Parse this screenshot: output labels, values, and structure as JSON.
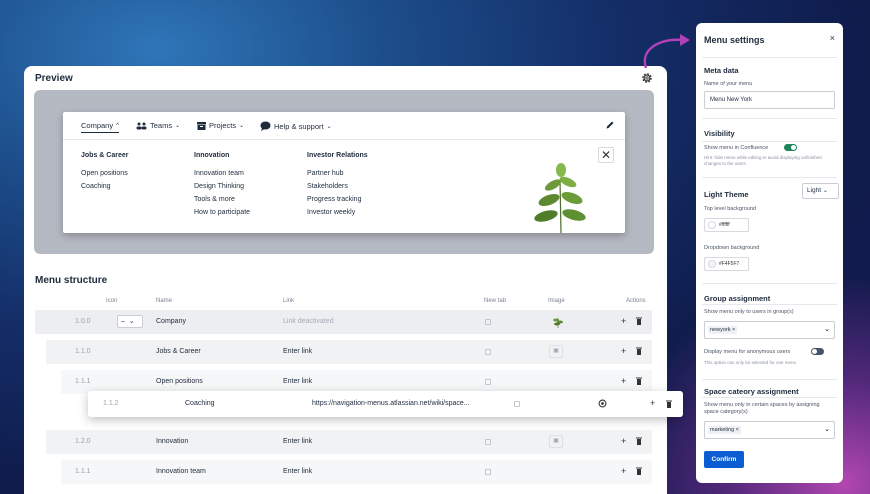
{
  "preview": {
    "title": "Preview",
    "nav": [
      "Company",
      "Teams",
      "Projects",
      "Help & support"
    ],
    "columns": [
      {
        "heading": "Jobs & Career",
        "items": [
          "Open positions",
          "Coaching"
        ]
      },
      {
        "heading": "Innovation",
        "items": [
          "Innovation team",
          "Design Thinking",
          "Tools & more",
          "How to participate"
        ]
      },
      {
        "heading": "Investor Relations",
        "items": [
          "Partner hub",
          "Stakeholders",
          "Progress tracking",
          "Investor weekly"
        ]
      }
    ]
  },
  "structure": {
    "title": "Menu structure",
    "headers": {
      "icon": "Icon",
      "name": "Name",
      "link": "Link",
      "newtab": "New tab",
      "image": "Image",
      "actions": "Actions"
    },
    "rows": [
      {
        "idx": "1.0.0",
        "name": "Company",
        "link": "Link deactivated"
      },
      {
        "idx": "1.1.0",
        "name": "Jobs & Career",
        "link": "Enter link"
      },
      {
        "idx": "1.1.1",
        "name": "Open positions",
        "link": "Enter link"
      },
      {
        "idx": "1.1.2",
        "name": "Coaching",
        "link": "https://navigation-menus.atlassian.net/wiki/space..."
      },
      {
        "idx": "1.2.0",
        "name": "Innovation",
        "link": "Enter link"
      },
      {
        "idx": "1.1.1",
        "name": "Innovation team",
        "link": "Enter link"
      }
    ]
  },
  "settings": {
    "title": "Menu settings",
    "close": "×",
    "meta_title": "Meta data",
    "name_label": "Name of your menu",
    "name_value": "Menu New York",
    "visibility_title": "Visibility",
    "show_confluence": "Show menu in Confluence",
    "visibility_help": "Hint: hide menu while editing to avoid displaying unfinished changes to the users.",
    "theme_title": "Light Theme",
    "theme_value": "Light",
    "top_bg_label": "Top level background",
    "top_bg_value": "#ffffff",
    "dropdown_bg_label": "Dropdown background",
    "dropdown_bg_value": "#F4F5F7",
    "group_title": "Group assignment",
    "group_label": "Show menu only to users in group(s)",
    "group_tag": "newyork",
    "anon_label": "Display menu for anonymous users",
    "anon_help": "This option can only be selected for one menu",
    "space_title": "Space cateory assignment",
    "space_label": "Show menu only in certain spaces by assigning space category(s)",
    "space_tag": "marketing",
    "confirm": "Confirm"
  },
  "colors": {
    "accent": "#0c5cd3",
    "toggle_on": "#1f845a",
    "arrow": "#b041b7"
  }
}
